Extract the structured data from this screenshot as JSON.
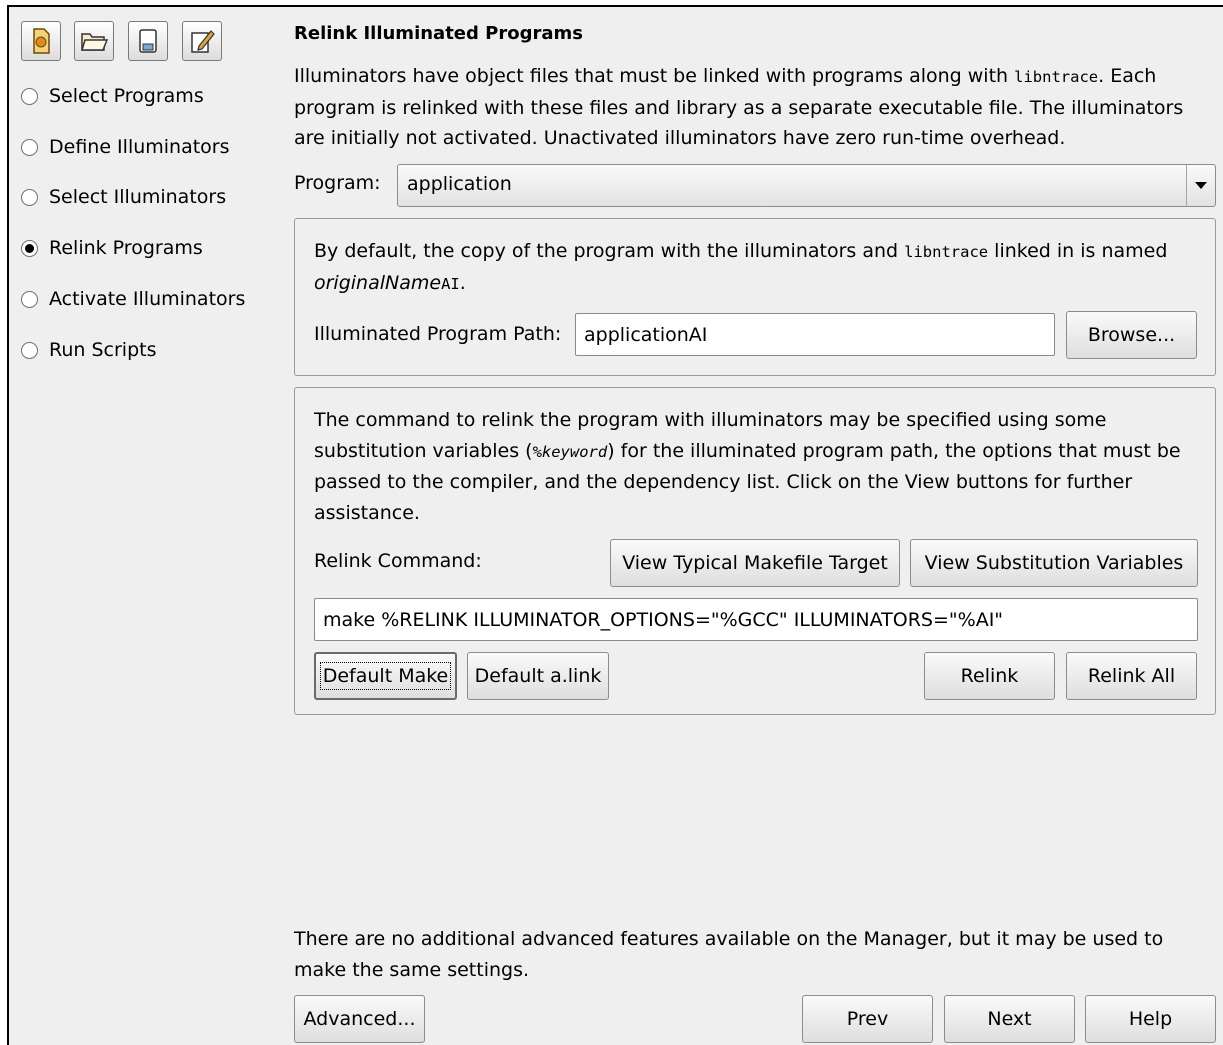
{
  "toolbar": {
    "icons": [
      "new-project-icon",
      "open-folder-icon",
      "save-icon",
      "edit-icon"
    ]
  },
  "steps": [
    {
      "label": "Select Programs",
      "selected": false
    },
    {
      "label": "Define Illuminators",
      "selected": false
    },
    {
      "label": "Select Illuminators",
      "selected": false
    },
    {
      "label": "Relink Programs",
      "selected": true
    },
    {
      "label": "Activate Illuminators",
      "selected": false
    },
    {
      "label": "Run Scripts",
      "selected": false
    }
  ],
  "main": {
    "title": "Relink Illuminated Programs",
    "intro": {
      "part1": "Illuminators have object files that must be linked with programs along with ",
      "code": "libntrace",
      "part2": ". Each program is relinked with these files and library as a separate executable file. The illuminators are initially not activated. Unactivated illuminators have zero run-time overhead."
    },
    "program_label": "Program:",
    "program_value": "application"
  },
  "path_panel": {
    "desc_part1": "By default, the copy of the program with the illuminators and ",
    "desc_code": "libntrace",
    "desc_part2": " linked in is named",
    "desc_italic": "originalName",
    "desc_code2": "AI",
    "desc_end": ".",
    "path_label": "Illuminated Program Path:",
    "path_value": "applicationAI",
    "browse_label": "Browse..."
  },
  "relink_panel": {
    "desc_part1": "The command to relink the program with illuminators may be specified using some substitution variables (",
    "desc_code": "%keyword",
    "desc_part2": ") for the illuminated program path, the options that must be passed to the compiler, and the dependency list. Click on the View buttons for further assistance.",
    "command_label": "Relink Command:",
    "view_target_label": "View Typical Makefile Target",
    "view_vars_label": "View Substitution Variables",
    "command_value": "make %RELINK ILLUMINATOR_OPTIONS=\"%GCC\" ILLUMINATORS=\"%AI\"",
    "default_make_label": "Default Make",
    "default_alink_label": "Default a.link",
    "relink_label": "Relink",
    "relink_all_label": "Relink All"
  },
  "footer": {
    "note": "There are no additional advanced features available on the Manager, but it may be used to make the same settings.",
    "advanced_label": "Advanced...",
    "prev_label": "Prev",
    "next_label": "Next",
    "help_label": "Help"
  }
}
